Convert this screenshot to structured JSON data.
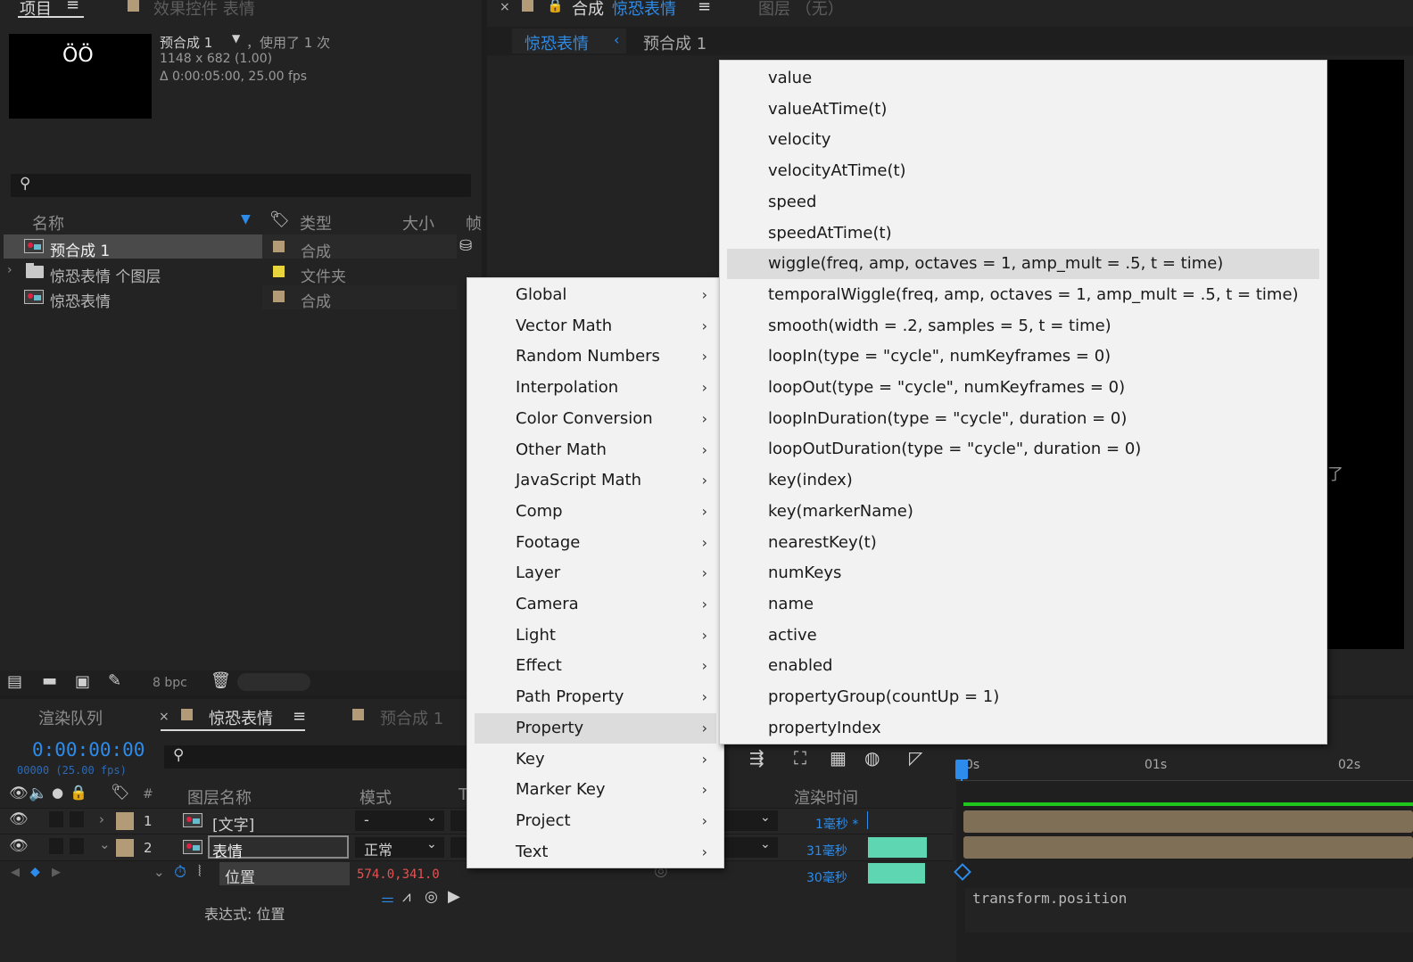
{
  "project_panel": {
    "tab_label": "项目",
    "effects_tab_label": "效果控件 表情",
    "selected_name": "预合成 1",
    "used_text": "，使用了 1 次",
    "dimensions": "1148 x 682 (1.00)",
    "duration": "Δ 0:00:05:00, 25.00 fps",
    "columns": {
      "name": "名称",
      "type": "类型",
      "size": "大小",
      "frame": "帧"
    },
    "items": [
      {
        "name": "预合成 1",
        "type": "合成",
        "color": "#b39b77"
      },
      {
        "name": "惊恐表情 个图层",
        "type": "文件夹",
        "color": "#e8d53c"
      },
      {
        "name": "惊恐表情",
        "type": "合成",
        "color": "#b39b77"
      }
    ],
    "bpc": "8 bpc"
  },
  "comp_panel": {
    "tab_prefix": "合成",
    "tab_name": "惊恐表情",
    "layer_tab": "图层 （无）",
    "breadcrumb_active": "惊恐表情",
    "breadcrumb_other": "预合成 1"
  },
  "timeline": {
    "render_queue_tab": "渲染队列",
    "comp_tab": "惊恐表情",
    "precomp_tab": "预合成 1",
    "timecode": "0:00:00:00",
    "frame_info": "00000 (25.00 fps)",
    "col_layer_name": "图层名称",
    "col_mode": "模式",
    "col_render_time": "渲染时间",
    "col_t": "T",
    "layers": [
      {
        "num": "1",
        "name": "[文字]",
        "mode": "-",
        "render_time": "1毫秒 *"
      },
      {
        "num": "2",
        "name": "表情",
        "mode": "正常",
        "render_time": "31毫秒"
      }
    ],
    "property": {
      "name": "位置",
      "value": "574.0,341.0",
      "render_time": "30毫秒"
    },
    "expression_label": "表达式: 位置",
    "expression_text": "transform.position",
    "ruler": [
      "0s",
      "01s",
      "02s"
    ]
  },
  "main_menu": {
    "items": [
      {
        "label": "Global"
      },
      {
        "label": "Vector Math"
      },
      {
        "label": "Random Numbers"
      },
      {
        "label": "Interpolation"
      },
      {
        "label": "Color Conversion"
      },
      {
        "label": "Other Math"
      },
      {
        "label": "JavaScript Math"
      },
      {
        "label": "Comp"
      },
      {
        "label": "Footage"
      },
      {
        "label": "Layer"
      },
      {
        "label": "Camera"
      },
      {
        "label": "Light"
      },
      {
        "label": "Effect"
      },
      {
        "label": "Path Property"
      },
      {
        "label": "Property"
      },
      {
        "label": "Key"
      },
      {
        "label": "Marker Key"
      },
      {
        "label": "Project"
      },
      {
        "label": "Text"
      }
    ],
    "highlighted_index": 14
  },
  "sub_menu": {
    "items": [
      "value",
      "valueAtTime(t)",
      "velocity",
      "velocityAtTime(t)",
      "speed",
      "speedAtTime(t)",
      "wiggle(freq, amp, octaves = 1, amp_mult = .5, t = time)",
      "temporalWiggle(freq, amp, octaves = 1, amp_mult = .5, t = time)",
      "smooth(width = .2, samples = 5, t = time)",
      "loopIn(type = \"cycle\", numKeyframes = 0)",
      "loopOut(type = \"cycle\", numKeyframes = 0)",
      "loopInDuration(type = \"cycle\", duration = 0)",
      "loopOutDuration(type = \"cycle\", duration = 0)",
      "key(index)",
      "key(markerName)",
      "nearestKey(t)",
      "numKeys",
      "name",
      "active",
      "enabled",
      "propertyGroup(countUp = 1)",
      "propertyIndex"
    ],
    "highlighted_index": 6
  },
  "colors": {
    "accent_blue": "#2d8ceb",
    "timebar_green": "#5ed6b1",
    "value_red": "#e05454"
  }
}
